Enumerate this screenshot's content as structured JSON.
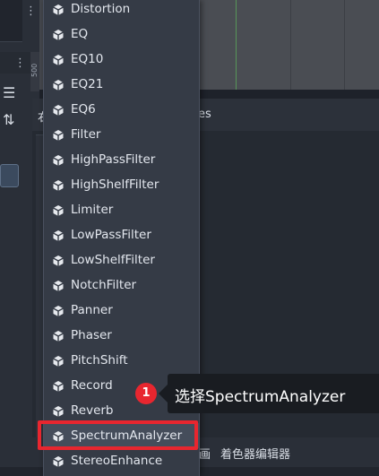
{
  "menu": {
    "items": [
      {
        "label": "Distortion"
      },
      {
        "label": "EQ"
      },
      {
        "label": "EQ10"
      },
      {
        "label": "EQ21"
      },
      {
        "label": "EQ6"
      },
      {
        "label": "Filter"
      },
      {
        "label": "HighPassFilter"
      },
      {
        "label": "HighShelfFilter"
      },
      {
        "label": "Limiter"
      },
      {
        "label": "LowPassFilter"
      },
      {
        "label": "LowShelfFilter"
      },
      {
        "label": "NotchFilter"
      },
      {
        "label": "Panner"
      },
      {
        "label": "Phaser"
      },
      {
        "label": "PitchShift"
      },
      {
        "label": "Record"
      },
      {
        "label": "Reverb"
      },
      {
        "label": "SpectrumAnalyzer"
      },
      {
        "label": "StereoEnhance"
      }
    ],
    "selected": "SpectrumAnalyzer",
    "item_icon": "resource-cube-icon"
  },
  "annotation": {
    "step": "1",
    "text": "选择SpectrumAnalyzer",
    "accent": "#e8262f"
  },
  "background": {
    "dock_title": "res",
    "dock_title_prefix": "右",
    "ruler_label": "500",
    "bottom_tabs": [
      "画",
      "着色器编辑器"
    ]
  }
}
